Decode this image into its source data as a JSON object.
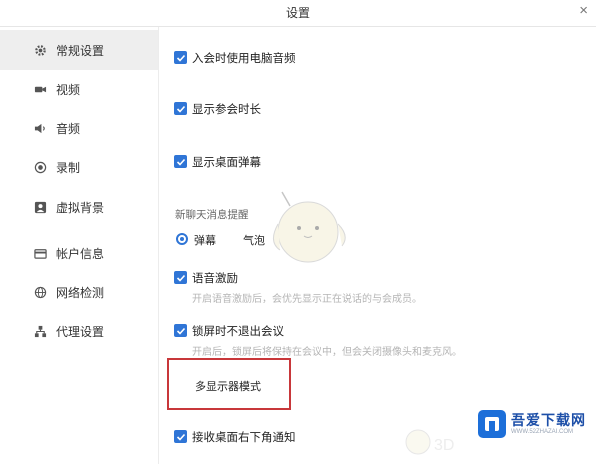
{
  "window": {
    "title": "设置",
    "close_glyph": "×"
  },
  "sidebar": {
    "items": [
      {
        "label": "常规设置",
        "icon": "gear-icon",
        "active": true
      },
      {
        "label": "视频",
        "icon": "camera-icon",
        "active": false
      },
      {
        "label": "音频",
        "icon": "speaker-icon",
        "active": false
      },
      {
        "label": "录制",
        "icon": "record-icon",
        "active": false
      },
      {
        "label": "虚拟背景",
        "icon": "person-icon",
        "active": false
      },
      {
        "label": "帐户信息",
        "icon": "card-icon",
        "active": false
      },
      {
        "label": "网络检测",
        "icon": "globe-icon",
        "active": false
      },
      {
        "label": "代理设置",
        "icon": "network-icon",
        "active": false
      }
    ]
  },
  "general": {
    "join_audio": {
      "label": "入会时使用电脑音频",
      "checked": true
    },
    "show_duration": {
      "label": "显示参会时长",
      "checked": true
    },
    "show_danmaku": {
      "label": "显示桌面弹幕",
      "checked": true
    },
    "chat_reminder": {
      "label": "新聊天消息提醒",
      "options": [
        {
          "label": "弹幕",
          "selected": true
        },
        {
          "label": "气泡",
          "selected": false
        }
      ]
    },
    "voice_excite": {
      "label": "语音激励",
      "checked": true,
      "desc": "开启语音激励后，会优先显示正在说话的与会成员。"
    },
    "lock_screen": {
      "label": "锁屏时不退出会议",
      "checked": true,
      "desc": "开启后，锁屏后将保持在会议中，但会关闭摄像头和麦克风。"
    },
    "multi_display": {
      "label": "多显示器模式"
    },
    "desktop_notify": {
      "label": "接收桌面右下角通知",
      "checked": true
    }
  },
  "watermark": {
    "logo_text": "吾爱下载网",
    "logo_sub": "WWW.52ZHAZAI.COM",
    "small_text": "3D"
  },
  "colors": {
    "accent": "#2f75d6",
    "highlight_box": "#c8373a",
    "sidebar_active": "#eeeeee"
  }
}
